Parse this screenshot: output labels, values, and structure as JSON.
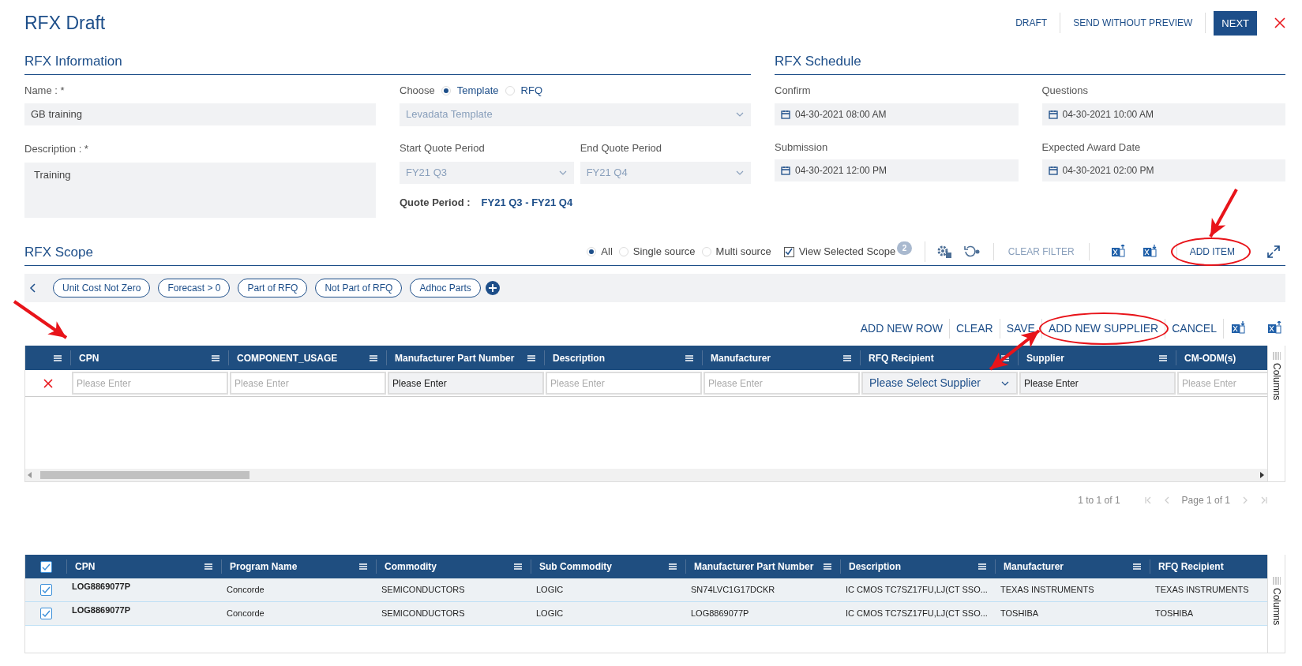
{
  "header": {
    "title": "RFX Draft",
    "actions": [
      {
        "label": "DRAFT",
        "kind": "link"
      },
      {
        "label": "SEND WITHOUT PREVIEW",
        "kind": "link"
      },
      {
        "label": "NEXT",
        "kind": "primary"
      }
    ]
  },
  "information": {
    "title": "RFX Information",
    "name": {
      "label": "Name : *",
      "value": "GB training"
    },
    "description": {
      "label": "Description : *",
      "value": "Training"
    },
    "choose": {
      "label": "Choose",
      "options": [
        {
          "label": "Template",
          "selected": true
        },
        {
          "label": "RFQ",
          "selected": false
        }
      ]
    },
    "template": {
      "value": "Levadata Template"
    },
    "start_quote": {
      "label": "Start Quote Period",
      "value": "FY21 Q3"
    },
    "end_quote": {
      "label": "End Quote Period",
      "value": "FY21 Q4"
    },
    "quote_period": {
      "label": "Quote Period :",
      "value": "FY21 Q3 - FY21 Q4"
    }
  },
  "schedule": {
    "title": "RFX Schedule",
    "fields": [
      {
        "label": "Confirm",
        "value": "04-30-2021 08:00 AM"
      },
      {
        "label": "Questions",
        "value": "04-30-2021 10:00 AM"
      },
      {
        "label": "Submission",
        "value": "04-30-2021 12:00 PM"
      },
      {
        "label": "Expected Award Date",
        "value": "04-30-2021 02:00 PM"
      }
    ]
  },
  "scope": {
    "title": "RFX Scope",
    "source_options": [
      {
        "label": "All",
        "selected": true
      },
      {
        "label": "Single source",
        "selected": false
      },
      {
        "label": "Multi source",
        "selected": false
      }
    ],
    "view_selected": {
      "label": "View Selected Scope",
      "checked": true,
      "count": "2"
    },
    "clear_filter": "CLEAR FILTER",
    "add_item": {
      "label": "ADD ITEM",
      "highlighted": true
    },
    "filters": [
      "Unit Cost Not Zero",
      "Forecast > 0",
      "Part of RFQ",
      "Not Part of RFQ",
      "Adhoc Parts"
    ]
  },
  "editor": {
    "actions": [
      {
        "label": "ADD NEW ROW",
        "highlighted": false
      },
      {
        "label": "CLEAR",
        "highlighted": false
      },
      {
        "label": "SAVE",
        "highlighted": false
      },
      {
        "label": "ADD NEW SUPPLIER",
        "highlighted": true
      },
      {
        "label": "CANCEL",
        "highlighted": false
      }
    ],
    "columns": [
      "CPN",
      "COMPONENT_USAGE",
      "Manufacturer Part Number",
      "Description",
      "Manufacturer",
      "RFQ Recipient",
      "Supplier",
      "CM-ODM(s)"
    ],
    "row": [
      {
        "kind": "input",
        "placeholder": "Please Enter"
      },
      {
        "kind": "input",
        "placeholder": "Please Enter"
      },
      {
        "kind": "text",
        "value": "Please Enter"
      },
      {
        "kind": "input",
        "placeholder": "Please Enter"
      },
      {
        "kind": "input",
        "placeholder": "Please Enter"
      },
      {
        "kind": "select",
        "value": "Please Select Supplier"
      },
      {
        "kind": "text",
        "value": "Please Enter"
      },
      {
        "kind": "input",
        "placeholder": "Please Enter"
      }
    ],
    "side_tab": "Columns",
    "range": "1 to 1 of 1",
    "page": "Page 1 of 1"
  },
  "selected_table": {
    "all_checked": true,
    "columns": [
      "CPN",
      "Program Name",
      "Commodity",
      "Sub Commodity",
      "Manufacturer Part Number",
      "Description",
      "Manufacturer",
      "RFQ Recipient"
    ],
    "rows": [
      {
        "checked": true,
        "cells": [
          "LOG8869077P",
          "Concorde",
          "SEMICONDUCTORS",
          "LOGIC",
          "SN74LVC1G17DCKR",
          "IC CMOS TC7SZ17FU,LJ(CT SSO...",
          "TEXAS INSTRUMENTS",
          "TEXAS INSTRUMENTS"
        ]
      },
      {
        "checked": true,
        "cells": [
          "LOG8869077P",
          "Concorde",
          "SEMICONDUCTORS",
          "LOGIC",
          "LOG8869077P",
          "IC CMOS TC7SZ17FU,LJ(CT SSO...",
          "TOSHIBA",
          "TOSHIBA"
        ]
      }
    ],
    "side_tab": "Columns"
  }
}
